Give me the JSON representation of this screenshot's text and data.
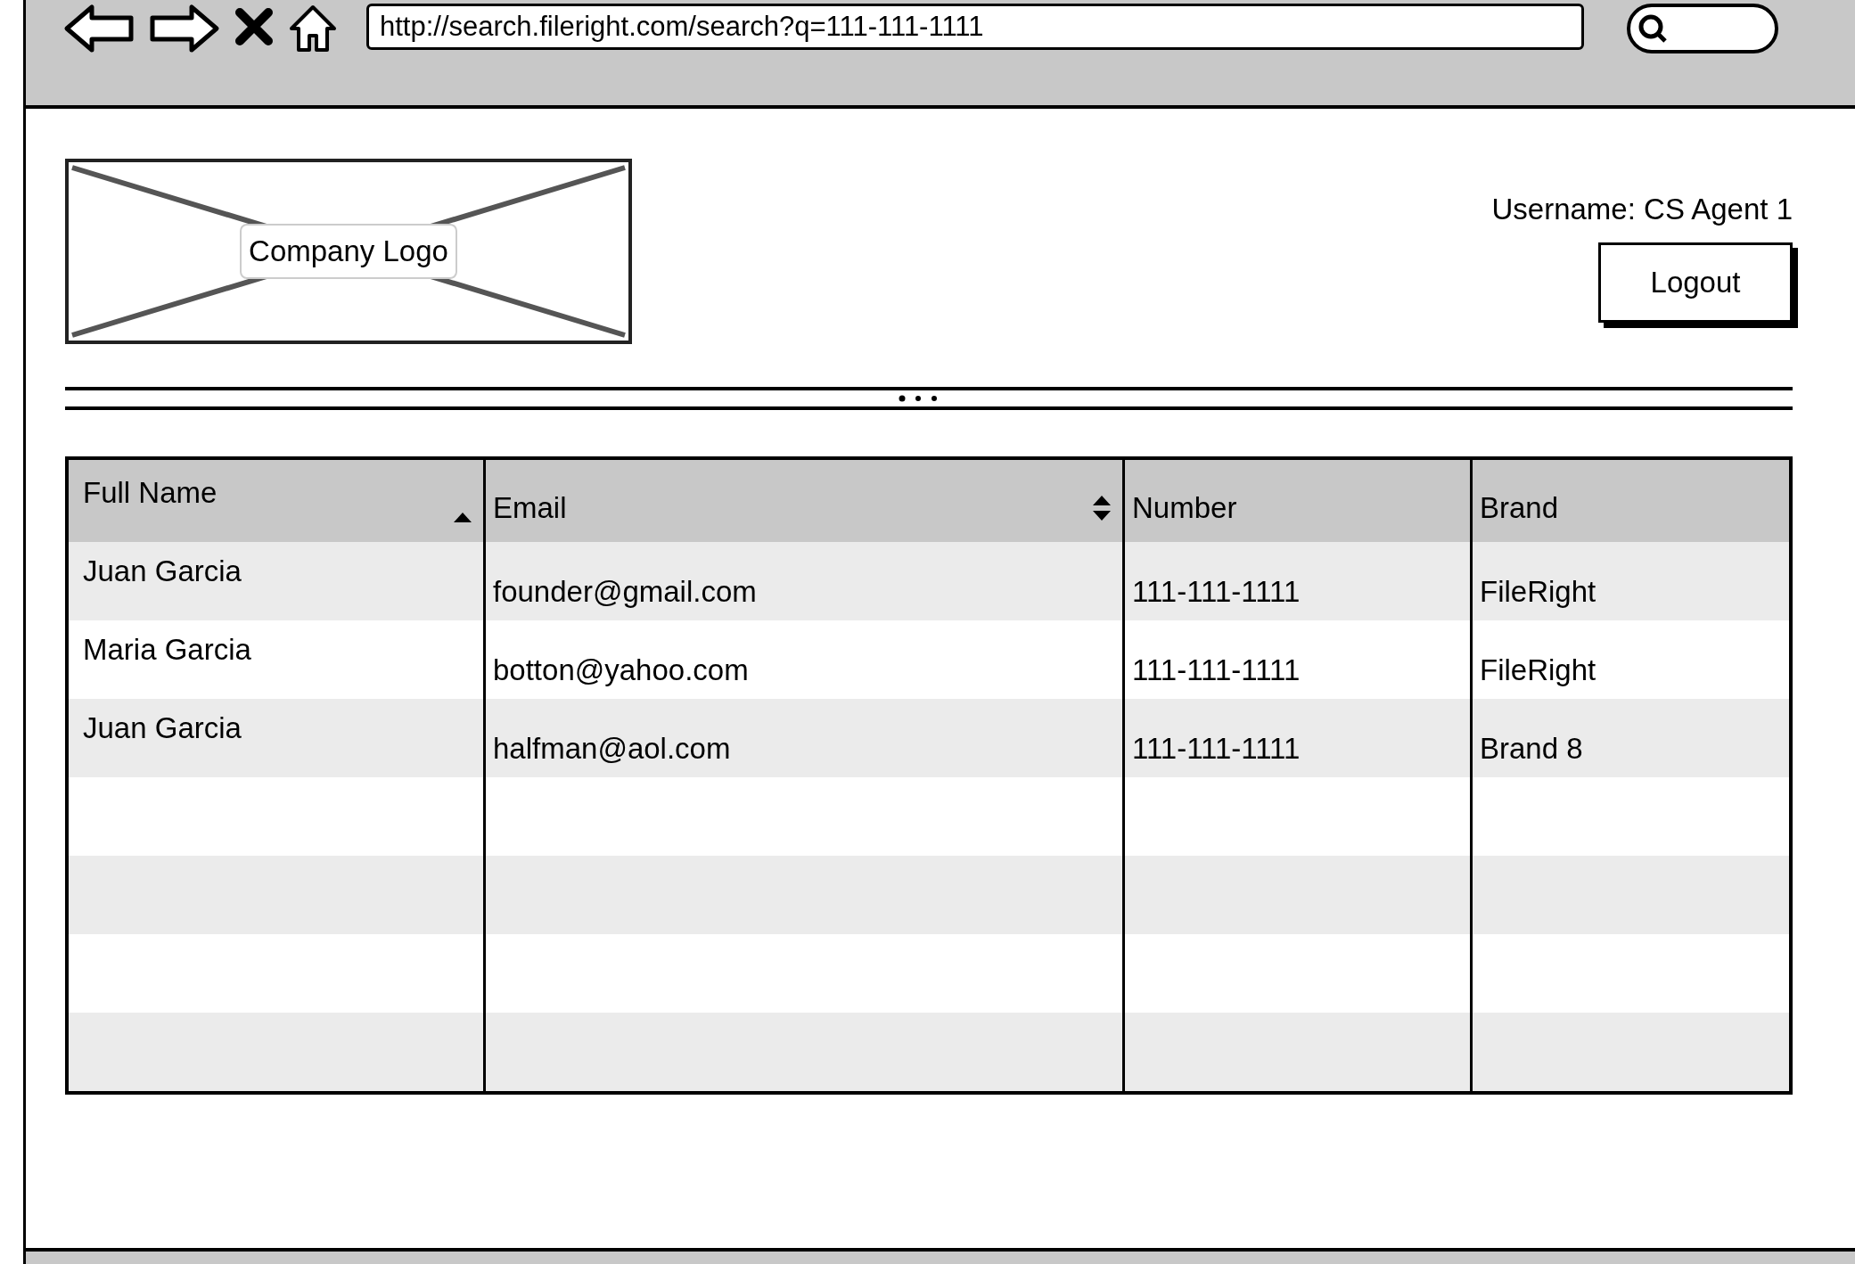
{
  "browser": {
    "url": "http://search.fileright.com/search?q=111-111-1111"
  },
  "header": {
    "logo": {
      "label": "Company Logo"
    },
    "username": "Username: CS Agent 1",
    "logout": "Logout"
  },
  "table": {
    "columns": [
      {
        "label": "Full Name",
        "sortable": true,
        "sorted": true
      },
      {
        "label": "Email",
        "sortable": true,
        "sorted": false
      },
      {
        "label": "Number",
        "sortable": false,
        "sorted": false
      },
      {
        "label": "Brand",
        "sortable": false,
        "sorted": false
      }
    ],
    "rows": [
      [
        "Juan Garcia",
        "founder@gmail.com",
        "111-111-1111",
        "FileRight"
      ],
      [
        "Maria Garcia",
        "botton@yahoo.com",
        "111-111-1111",
        "FileRight"
      ],
      [
        "Juan Garcia",
        "halfman@aol.com",
        "111-111-1111",
        "Brand 8"
      ]
    ]
  }
}
